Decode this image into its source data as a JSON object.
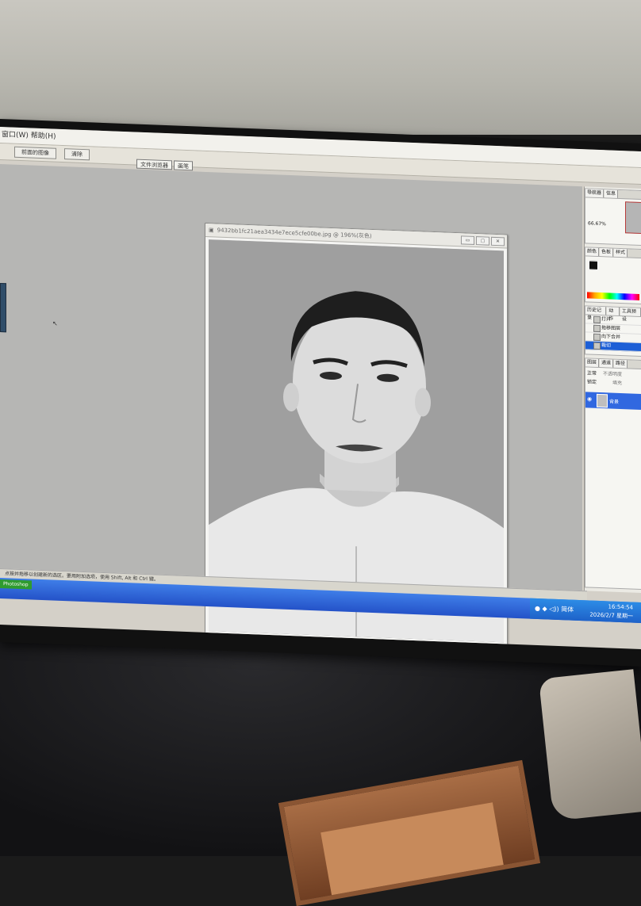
{
  "menubar": {
    "text": "窗口(W)  帮助(H)"
  },
  "options": {
    "button_1": "前面的图像",
    "button_2": "清除"
  },
  "palette_well": {
    "tab_1": "文件浏览器",
    "tab_2": "画笔"
  },
  "document": {
    "title": "9432bb1fc21aea3434e7ece5cfe00be.jpg @ 196%(灰色)",
    "buttons": [
      "▭",
      "▢",
      "✕"
    ]
  },
  "navigator": {
    "tabs": [
      "导航器",
      "信息"
    ],
    "zoom": "66.67%"
  },
  "color_panel": {
    "tabs": [
      "颜色",
      "色板",
      "样式"
    ]
  },
  "history": {
    "tabs": [
      "历史记录",
      "动作",
      "工具预设"
    ],
    "items": [
      "打开",
      "拖移图层",
      "向下合并",
      "裁切"
    ],
    "active_index": 3
  },
  "layers": {
    "tabs": [
      "图层",
      "通道",
      "路径"
    ],
    "blend_mode": "正常",
    "opacity_label": "不透明度",
    "lock_label": "锁定",
    "fill_label": "填充",
    "layer_name": "背景"
  },
  "statusbar": {
    "text": "点按并拖移以创建新的选区。要用附加选项，使用 Shift, Alt 和 Ctrl 键。"
  },
  "taskbar": {
    "start_label": "Photoshop",
    "time": "16:54:54",
    "date": "2026/2/7 星期一",
    "lang": "简体"
  },
  "colors": {
    "taskbar": "#2452c8",
    "active_highlight": "#1d5fd6",
    "workspace": "#b6b6b4"
  }
}
